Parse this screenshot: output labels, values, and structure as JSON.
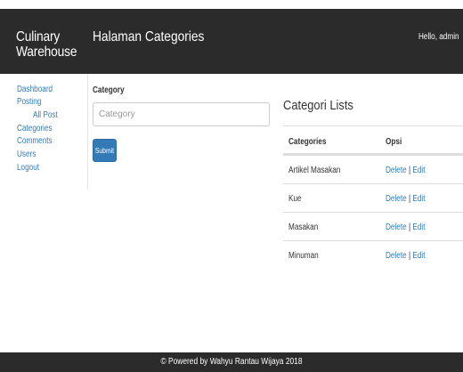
{
  "header": {
    "brand": "Culinary Warehouse",
    "title": "Halaman Categories",
    "greeting": "Hello, admin"
  },
  "sidebar": {
    "items": [
      {
        "label": "Dashboard"
      },
      {
        "label": "Posting"
      },
      {
        "label": "All Post"
      },
      {
        "label": "Categories"
      },
      {
        "label": "Comments"
      },
      {
        "label": "Users"
      },
      {
        "label": "Logout"
      }
    ]
  },
  "form": {
    "label": "Category",
    "placeholder": "Category",
    "value": "",
    "submit_label": "Submit"
  },
  "list": {
    "title": "Categori Lists",
    "columns": [
      "Categories",
      "Opsi"
    ],
    "rows": [
      {
        "name": "Artikel Masakan",
        "delete": "Delete",
        "separator": " | ",
        "edit": "Edit"
      },
      {
        "name": "Kue",
        "delete": "Delete",
        "separator": " | ",
        "edit": "Edit"
      },
      {
        "name": "Masakan",
        "delete": "Delete",
        "separator": " | ",
        "edit": "Edit"
      },
      {
        "name": "Minuman",
        "delete": "Delete",
        "separator": " | ",
        "edit": "Edit"
      }
    ]
  },
  "footer": {
    "text": "© Powered by Wahyu Rantau Wijaya 2018"
  },
  "colors": {
    "navbar": "#2b2b2b",
    "link": "#337ab7",
    "button": "#337ab7"
  }
}
